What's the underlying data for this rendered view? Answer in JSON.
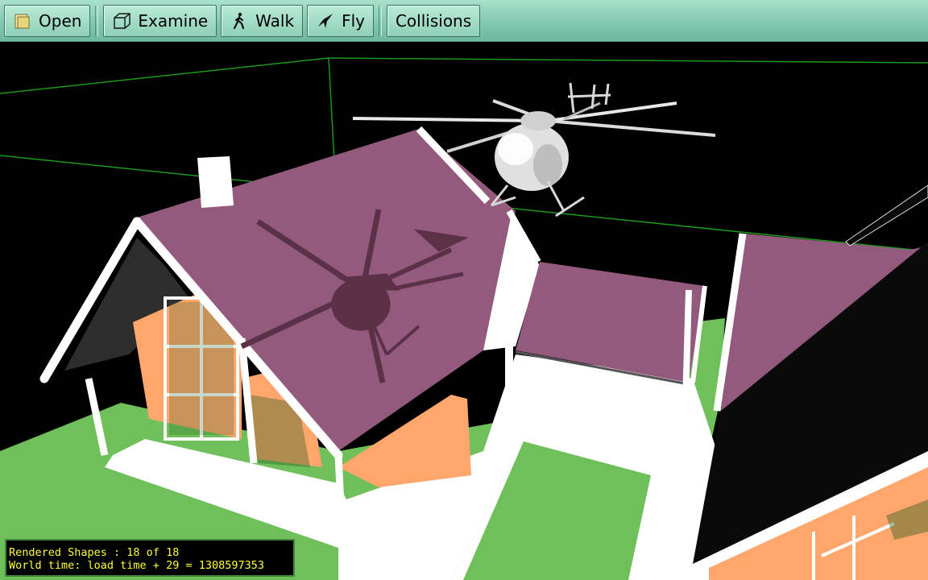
{
  "toolbar": {
    "open_label": "Open",
    "examine_label": "Examine",
    "walk_label": "Walk",
    "fly_label": "Fly",
    "collisions_label": "Collisions",
    "open_icon": "folder-icon",
    "examine_icon": "cube-icon",
    "walk_icon": "walking-person-icon",
    "fly_icon": "bird-icon"
  },
  "status": {
    "line1": "Rendered Shapes : 18 of 18",
    "line2": "World time: load time + 29 = 1308597353"
  },
  "colors": {
    "roof": "#935a7e",
    "wall": "#ffa66c",
    "grass": "#6fbf5a",
    "trim": "#ffffff",
    "bounding_box": "#1a9a1a",
    "status_text": "#ffff33",
    "toolbar": "#8fd1b9"
  }
}
